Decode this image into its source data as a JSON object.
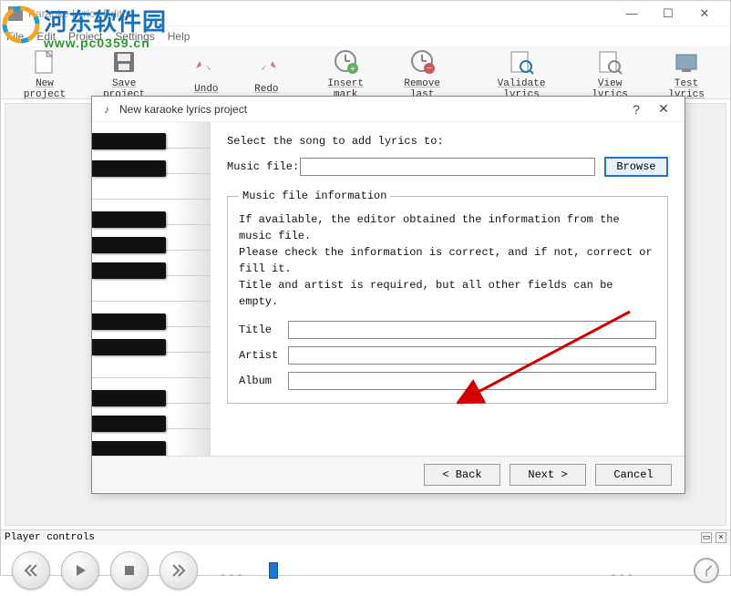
{
  "app": {
    "title": "Karaoke Lyrics Editor"
  },
  "menu": {
    "file": "File",
    "edit": "Edit",
    "project": "Project",
    "settings": "Settings",
    "help": "Help"
  },
  "toolbar": {
    "new_project": "New project",
    "save_project": "Save project",
    "undo": "Undo",
    "redo": "Redo",
    "insert_mark": "Insert mark",
    "remove_last": "Remove last",
    "validate_lyrics": "Validate lyrics",
    "view_lyrics": "View lyrics",
    "test_lyrics": "Test lyrics"
  },
  "dialog": {
    "title": "New karaoke lyrics project",
    "select_label": "Select the song to add lyrics to:",
    "music_file_label": "Music file:",
    "music_file_value": "",
    "browse": "Browse",
    "fieldset_legend": "Music file information",
    "info_line1": "If available, the editor obtained the information from the music file.",
    "info_line2": "Please check the information is correct, and if not, correct or fill it.",
    "info_line3": "Title and artist is required, but all other fields can be empty.",
    "title_label": "Title",
    "title_value": "",
    "artist_label": "Artist",
    "artist_value": "",
    "album_label": "Album",
    "album_value": "",
    "back": "< Back",
    "next": "Next >",
    "cancel": "Cancel"
  },
  "player": {
    "header": "Player controls"
  },
  "overlay": {
    "cn": "河东软件园",
    "url": "www.pc0359.cn"
  }
}
